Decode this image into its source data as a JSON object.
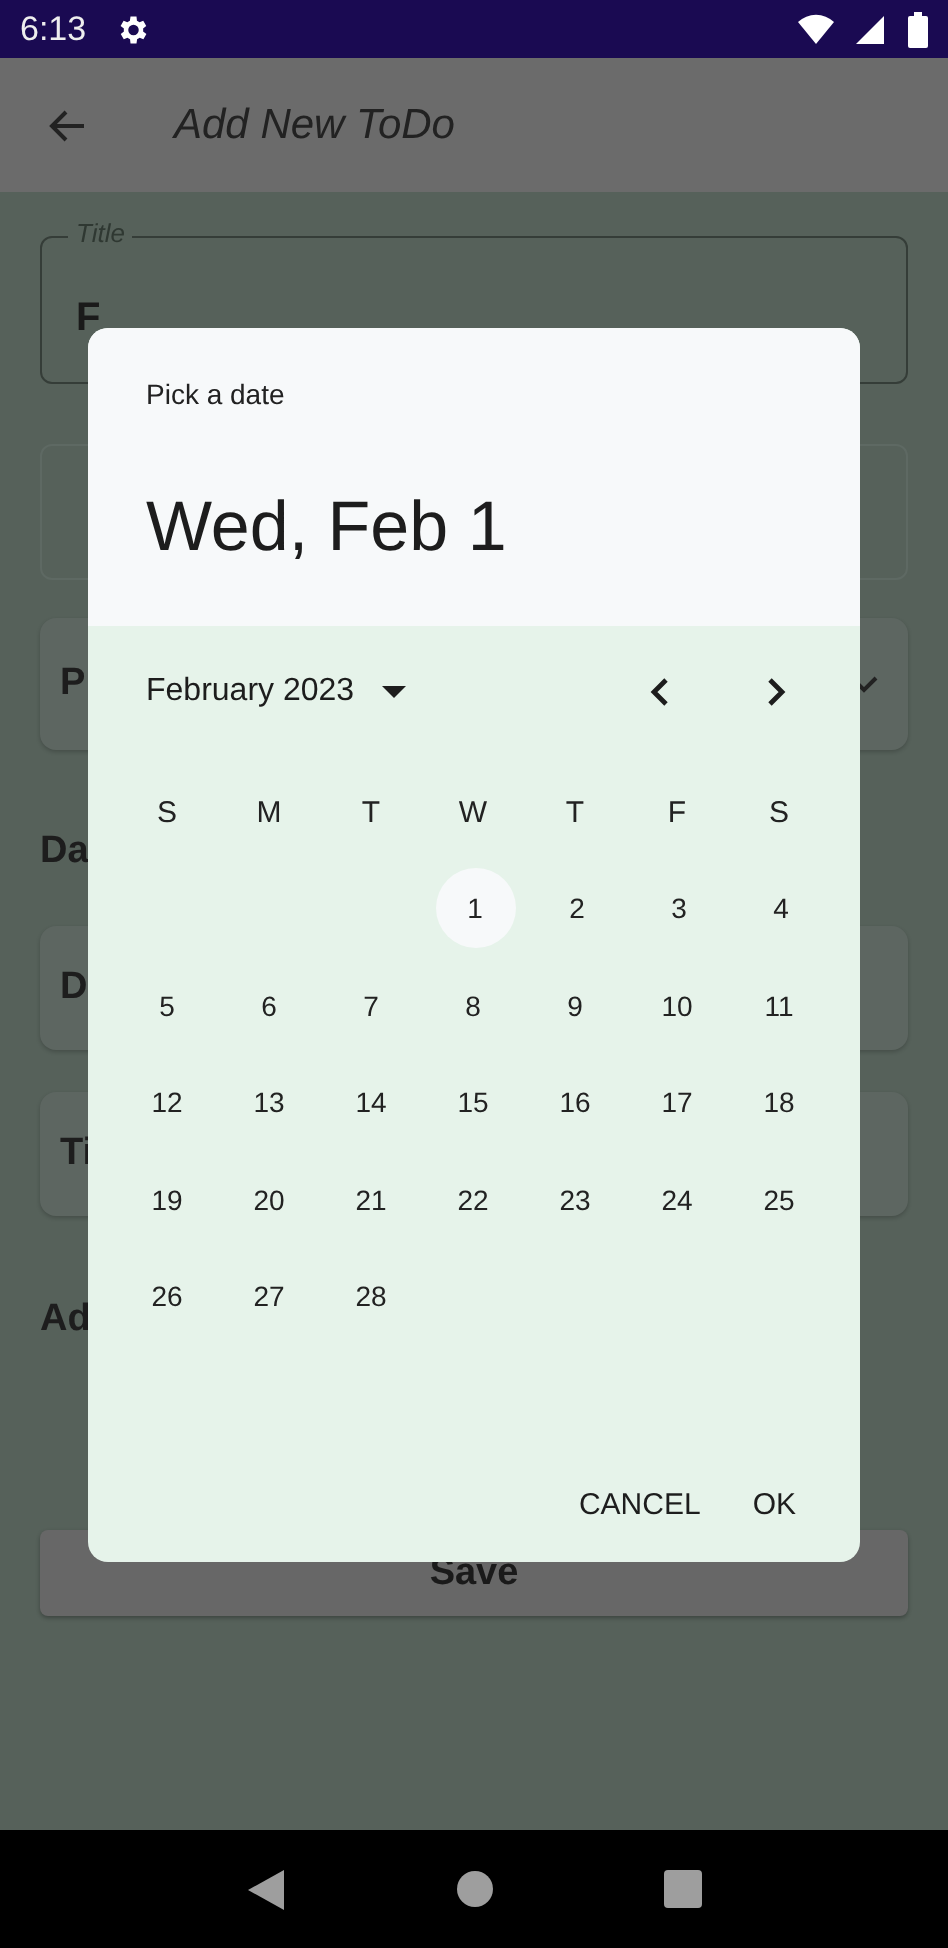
{
  "status_bar": {
    "time": "6:13"
  },
  "app_bar": {
    "title": "Add New ToDo"
  },
  "form": {
    "title_field": {
      "label": "Title",
      "value": "F"
    },
    "priority_card": {
      "label": "P"
    },
    "date_section": {
      "label": "Da"
    },
    "date_card": {
      "label": "D"
    },
    "time_card": {
      "label": "Ti"
    },
    "add_section": {
      "label": "Ad"
    },
    "save_button": {
      "label": "Save"
    }
  },
  "date_picker": {
    "heading": "Pick a date",
    "selected_date": "Wed, Feb 1",
    "month_label": "February 2023",
    "weekdays": [
      "S",
      "M",
      "T",
      "W",
      "T",
      "F",
      "S"
    ],
    "weeks": [
      {
        "days": [
          {
            "label": "1",
            "selected": true
          },
          {
            "label": "2",
            "selected": false
          },
          {
            "label": "3",
            "selected": false
          },
          {
            "label": "4",
            "selected": false
          }
        ]
      },
      {
        "days": [
          {
            "label": "5",
            "selected": false
          },
          {
            "label": "6",
            "selected": false
          },
          {
            "label": "7",
            "selected": false
          },
          {
            "label": "8",
            "selected": false
          },
          {
            "label": "9",
            "selected": false
          },
          {
            "label": "10",
            "selected": false
          },
          {
            "label": "11",
            "selected": false
          }
        ]
      },
      {
        "days": [
          {
            "label": "12",
            "selected": false
          },
          {
            "label": "13",
            "selected": false
          },
          {
            "label": "14",
            "selected": false
          },
          {
            "label": "15",
            "selected": false
          },
          {
            "label": "16",
            "selected": false
          },
          {
            "label": "17",
            "selected": false
          },
          {
            "label": "18",
            "selected": false
          }
        ]
      },
      {
        "days": [
          {
            "label": "19",
            "selected": false
          },
          {
            "label": "20",
            "selected": false
          },
          {
            "label": "21",
            "selected": false
          },
          {
            "label": "22",
            "selected": false
          },
          {
            "label": "23",
            "selected": false
          },
          {
            "label": "24",
            "selected": false
          },
          {
            "label": "25",
            "selected": false
          }
        ]
      },
      {
        "days": [
          {
            "label": "26",
            "selected": false
          },
          {
            "label": "27",
            "selected": false
          },
          {
            "label": "28",
            "selected": false
          }
        ]
      }
    ],
    "buttons": [
      "CANCEL",
      "OK"
    ]
  }
}
